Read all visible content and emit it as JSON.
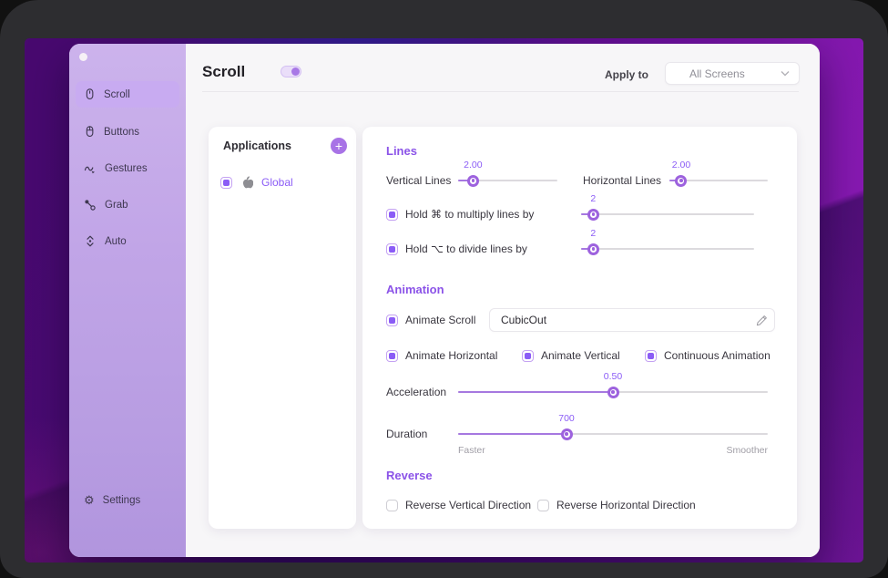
{
  "header": {
    "title": "Scroll",
    "toggle_on": true,
    "apply_to_label": "Apply to",
    "screen_select": "All Screens"
  },
  "sidebar": {
    "items": [
      {
        "label": "Scroll",
        "selected": true
      },
      {
        "label": "Buttons",
        "selected": false
      },
      {
        "label": "Gestures",
        "selected": false
      },
      {
        "label": "Grab",
        "selected": false
      },
      {
        "label": "Auto",
        "selected": false
      }
    ],
    "settings_label": "Settings",
    "gear_glyph": "⚙"
  },
  "applications": {
    "title": "Applications",
    "add_button": "+",
    "items": [
      {
        "label": "Global",
        "checked": true
      }
    ]
  },
  "sections": {
    "lines": {
      "title": "Lines",
      "vertical_lines": {
        "label": "Vertical Lines",
        "value": "2.00",
        "percent": 15
      },
      "horizontal_lines": {
        "label": "Horizontal Lines",
        "value": "2.00",
        "percent": 12
      },
      "multiply": {
        "label": "Hold ⌘ to multiply lines by",
        "checked": true,
        "value": "2",
        "percent": 7
      },
      "divide": {
        "label": "Hold ⌥ to divide lines by",
        "checked": true,
        "value": "2",
        "percent": 7
      }
    },
    "animation": {
      "title": "Animation",
      "animate_scroll": {
        "label": "Animate Scroll",
        "checked": true,
        "value": "CubicOut"
      },
      "options": [
        {
          "label": "Animate Horizontal",
          "checked": true
        },
        {
          "label": "Animate Vertical",
          "checked": true
        },
        {
          "label": "Continuous Animation",
          "checked": true
        }
      ],
      "acceleration": {
        "label": "Acceleration",
        "value": "0.50",
        "percent": 50
      },
      "duration": {
        "label": "Duration",
        "value": "700",
        "percent": 35,
        "min_label": "Faster",
        "max_label": "Smoother"
      }
    },
    "reverse": {
      "title": "Reverse",
      "options": [
        {
          "label": "Reverse Vertical Direction",
          "checked": false
        },
        {
          "label": "Reverse Horizontal Direction",
          "checked": false
        }
      ]
    }
  },
  "colors": {
    "accent": "#8b5cf6",
    "slider": "#a678e0",
    "sidebar_selected": "#c8abf1",
    "wallpaper": "#5c0d8a"
  }
}
